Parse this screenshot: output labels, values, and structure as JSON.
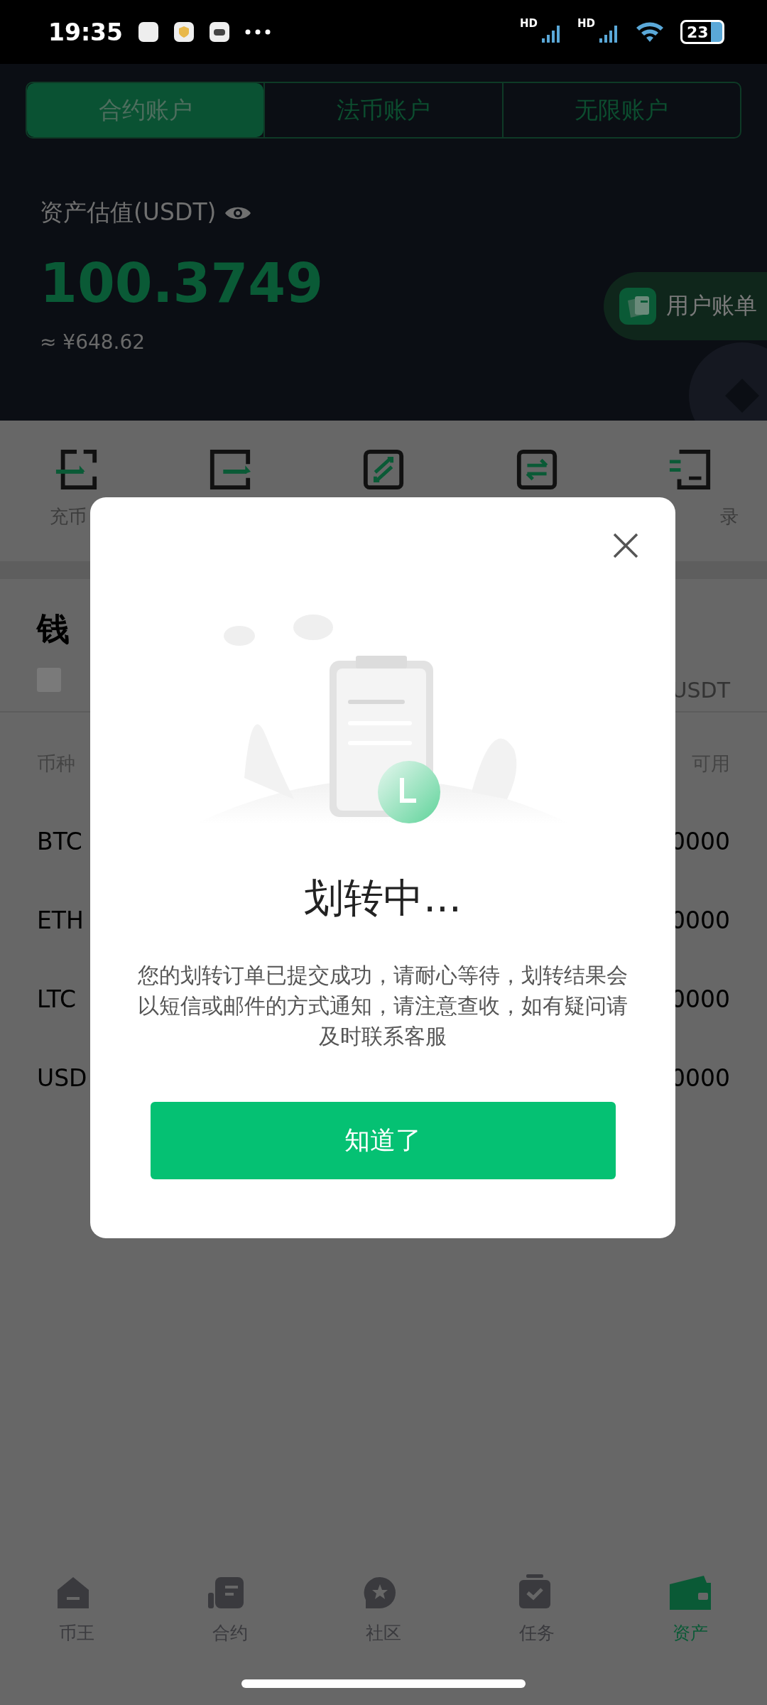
{
  "status_bar": {
    "time": "19:35",
    "signals": [
      "HD",
      "HD"
    ],
    "battery": "23"
  },
  "account_tabs": [
    {
      "label": "合约账户",
      "selected": true
    },
    {
      "label": "法币账户",
      "selected": false
    },
    {
      "label": "无限账户",
      "selected": false
    }
  ],
  "asset_summary": {
    "label": "资产估值(USDT)",
    "value": "100.3749",
    "fiat_value": "≈ ¥648.62"
  },
  "bill_button": {
    "label": "用户账单"
  },
  "actions": [
    {
      "kind": "deposit",
      "label": "充币"
    },
    {
      "kind": "withdraw"
    },
    {
      "kind": "convert"
    },
    {
      "kind": "transfer"
    },
    {
      "kind": "record",
      "label": "录"
    }
  ],
  "wallet": {
    "title": "钱",
    "hide_checkbox": {
      "checked": false
    },
    "unit": "USDT"
  },
  "table": {
    "columns": [
      "币种",
      "可用"
    ],
    "rows": [
      {
        "coin": "BTC",
        "available": "0000"
      },
      {
        "coin": "ETH",
        "available": "0000"
      },
      {
        "coin": "LTC",
        "available": "0000"
      },
      {
        "coin": "USD",
        "available": "0000"
      }
    ]
  },
  "bottom_nav": [
    {
      "kind": "home",
      "label": "币王",
      "selected": false
    },
    {
      "kind": "contract",
      "label": "合约",
      "selected": false
    },
    {
      "kind": "community",
      "label": "社区",
      "selected": false
    },
    {
      "kind": "tasks",
      "label": "任务",
      "selected": false
    },
    {
      "kind": "assets",
      "label": "资产",
      "selected": true
    }
  ],
  "dialog": {
    "title": "划转中...",
    "message": "您的划转订单已提交成功，请耐心等待，划转结果会以短信或邮件的方式通知，请注意查收，如有疑问请及时联系客服",
    "button": "知道了"
  }
}
